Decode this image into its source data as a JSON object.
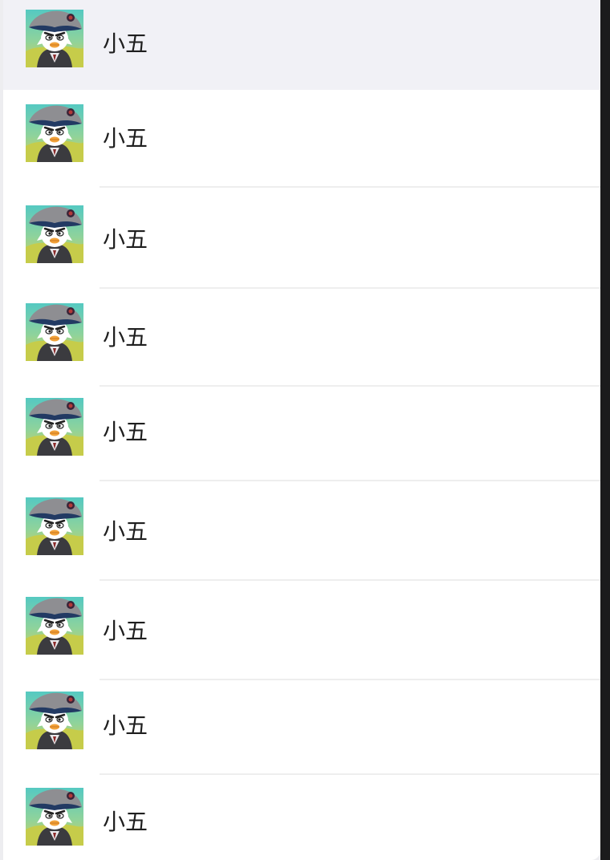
{
  "contacts": [
    {
      "name": "小五",
      "avatar_icon": "penguin-general-avatar",
      "selected": true
    },
    {
      "name": "小五",
      "avatar_icon": "penguin-general-avatar",
      "selected": false
    },
    {
      "name": "小五",
      "avatar_icon": "penguin-general-avatar",
      "selected": false
    },
    {
      "name": "小五",
      "avatar_icon": "penguin-general-avatar",
      "selected": false
    },
    {
      "name": "小五",
      "avatar_icon": "penguin-general-avatar",
      "selected": false
    },
    {
      "name": "小五",
      "avatar_icon": "penguin-general-avatar",
      "selected": false
    },
    {
      "name": "小五",
      "avatar_icon": "penguin-general-avatar",
      "selected": false
    },
    {
      "name": "小五",
      "avatar_icon": "penguin-general-avatar",
      "selected": false
    },
    {
      "name": "小五",
      "avatar_icon": "penguin-general-avatar",
      "selected": false
    }
  ],
  "colors": {
    "selected_row_background": "#f1f1f6",
    "row_background": "#ffffff",
    "divider": "#eeeeee",
    "name_text": "#1f1f1f"
  }
}
